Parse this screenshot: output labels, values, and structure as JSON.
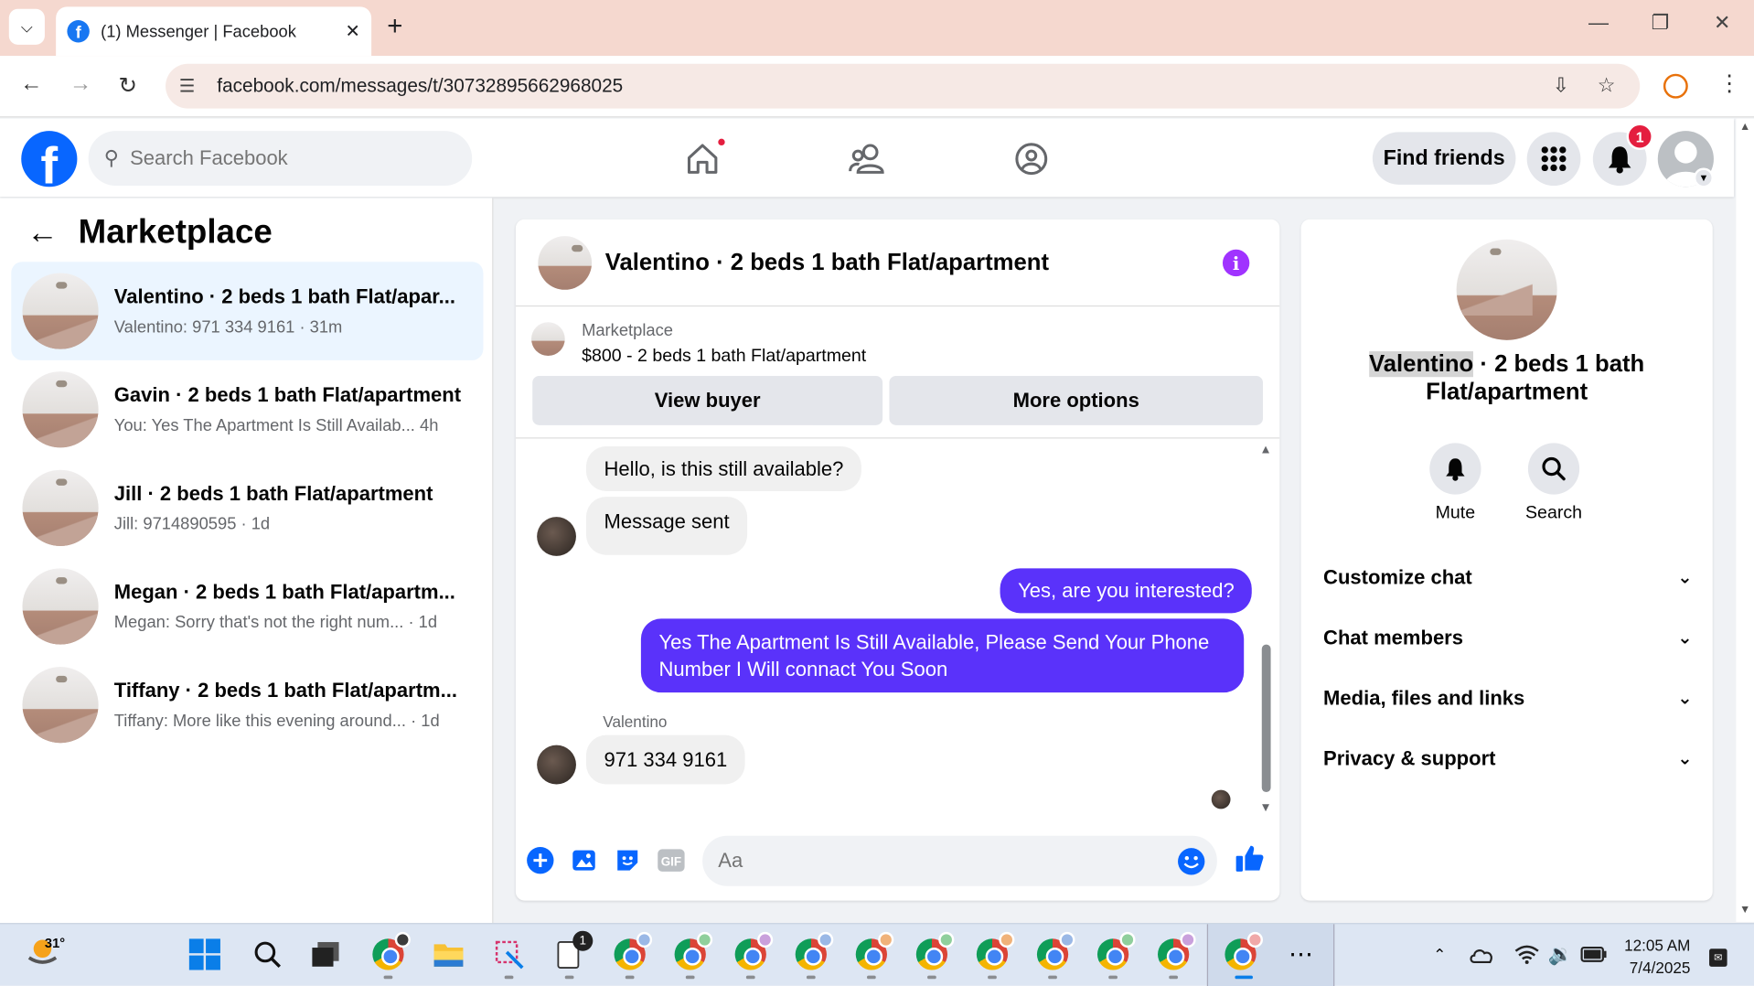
{
  "browser": {
    "tab_title": "(1) Messenger | Facebook",
    "url": "facebook.com/messages/t/30732895662968025"
  },
  "fb": {
    "search_placeholder": "Search Facebook",
    "find_friends": "Find friends",
    "notification_count": "1"
  },
  "left": {
    "title": "Marketplace",
    "threads": [
      {
        "title": "Valentino · 2 beds 1 bath Flat/apar...",
        "sub": "Valentino: 971 334 9161 · 31m"
      },
      {
        "title": "Gavin · 2 beds 1 bath Flat/apartment",
        "sub": "You: Yes The Apartment Is Still Availab... 4h"
      },
      {
        "title": "Jill · 2 beds 1 bath Flat/apartment",
        "sub": "Jill: 9714890595 · 1d"
      },
      {
        "title": "Megan · 2 beds 1 bath Flat/apartm...",
        "sub": "Megan: Sorry that's not the right num... · 1d"
      },
      {
        "title": "Tiffany · 2 beds 1 bath Flat/apartm...",
        "sub": "Tiffany: More like this evening around... · 1d"
      }
    ]
  },
  "chat": {
    "title": "Valentino · 2 beds 1 bath Flat/apartment",
    "marketplace_label": "Marketplace",
    "listing": "$800 - 2 beds 1 bath Flat/apartment",
    "view_buyer": "View buyer",
    "more_options": "More options",
    "messages": {
      "m1": "Hello, is this still available?",
      "m2": "Message sent",
      "m3": "Yes, are you interested?",
      "m4": "Yes The Apartment Is Still Available, Please Send Your Phone Number I Will connact You Soon",
      "sender": "Valentino",
      "m5": "971 334 9161"
    },
    "composer_placeholder": "Aa"
  },
  "right": {
    "name_highlight": "Valentino",
    "name_rest": " · 2 beds 1 bath Flat/apartment",
    "mute": "Mute",
    "search": "Search",
    "sections": [
      "Customize chat",
      "Chat members",
      "Media, files and links",
      "Privacy & support"
    ]
  },
  "taskbar": {
    "temp": "31°",
    "time": "12:05 AM",
    "date": "7/4/2025",
    "notepad_badge": "1"
  },
  "colors": {
    "fb_blue": "#0866ff",
    "messenger_purple": "#5a32fa",
    "active_thread": "#ebf5ff"
  }
}
